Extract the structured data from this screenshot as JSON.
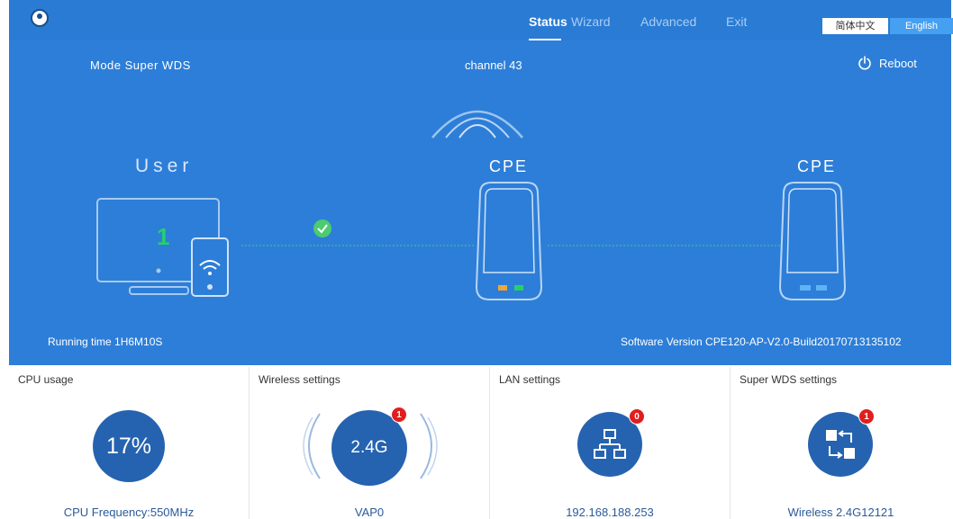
{
  "nav": {
    "items": [
      {
        "label": "Status"
      },
      {
        "label": "Wizard"
      },
      {
        "label": "Advanced"
      },
      {
        "label": "Exit"
      }
    ],
    "lang_cn": "简体中文",
    "lang_en": "English"
  },
  "hero": {
    "mode": "Mode Super WDS",
    "channel": "channel 43",
    "reboot": "Reboot",
    "user_label": "User",
    "user_count": "1",
    "cpe_left": "CPE",
    "cpe_right": "CPE",
    "running_time": "Running time  1H6M10S",
    "software_version": "Software Version  CPE120-AP-V2.0-Build20170713135102"
  },
  "panels": {
    "cpu": {
      "title": "CPU usage",
      "value": "17%",
      "footer": "CPU Frequency:550MHz"
    },
    "wireless": {
      "title": "Wireless settings",
      "value": "2.4G",
      "badge": "1",
      "footer": "VAP0"
    },
    "lan": {
      "title": "LAN settings",
      "badge": "0",
      "footer": "192.168.188.253"
    },
    "wds": {
      "title": "Super WDS settings",
      "badge": "1",
      "footer": "Wireless 2.4G12121"
    }
  },
  "colors": {
    "hero_bg": "#2d7ed8",
    "accent": "#2563b0",
    "badge": "#e01e1e",
    "link_green": "#25c26a"
  }
}
